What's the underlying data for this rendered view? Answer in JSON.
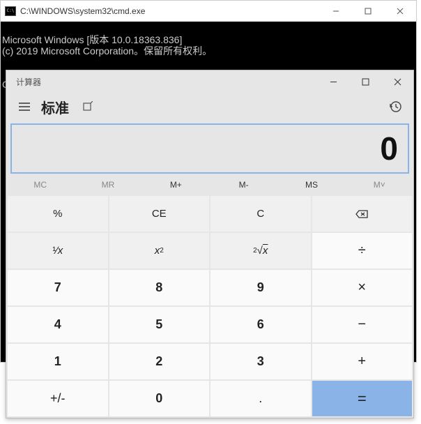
{
  "cmd": {
    "title": "C:\\WINDOWS\\system32\\cmd.exe",
    "line1": "Microsoft Windows [版本 10.0.18363.836]",
    "line2": "(c) 2019 Microsoft Corporation。保留所有权利。",
    "prompt": "C:\\Users\\Administrator>calc"
  },
  "calc": {
    "title": "计算器",
    "mode": "标准",
    "display": "0",
    "mem": {
      "mc": "MC",
      "mr": "MR",
      "mplus": "M+",
      "mminus": "M-",
      "ms": "MS",
      "mlist": "M˅"
    },
    "keys": {
      "percent": "%",
      "ce": "CE",
      "c": "C",
      "inv": "¹⁄ₓ",
      "sq": "x²",
      "root": "²√x",
      "div": "÷",
      "d7": "7",
      "d8": "8",
      "d9": "9",
      "mul": "×",
      "d4": "4",
      "d5": "5",
      "d6": "6",
      "sub": "−",
      "d1": "1",
      "d2": "2",
      "d3": "3",
      "add": "+",
      "neg": "+/-",
      "d0": "0",
      "dot": ".",
      "eq": "="
    }
  }
}
